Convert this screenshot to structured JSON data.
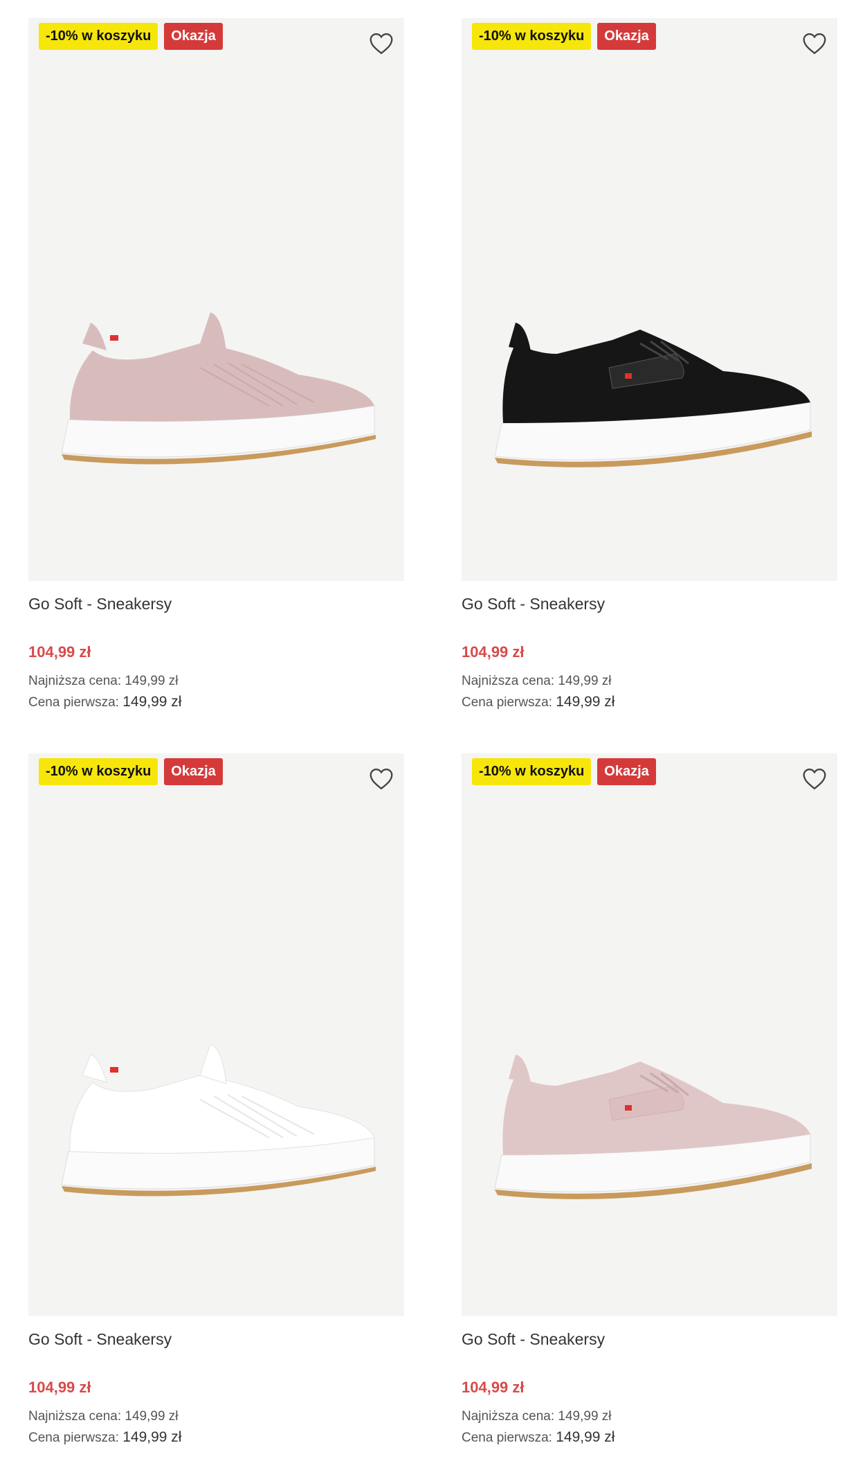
{
  "colors": {
    "sale_price": "#d84a4a",
    "badge_yellow": "#f6e60a",
    "badge_red": "#d53a3a",
    "image_bg": "#f4f4f3"
  },
  "products": [
    {
      "badge_discount": "-10% w koszyku",
      "badge_deal": "Okazja",
      "name": "Go Soft - Sneakersy",
      "price": "104,99 zł",
      "lowest_label": "Najniższa cena:",
      "lowest_value": "149,99 zł",
      "first_label": "Cena pierwsza:",
      "first_value": "149,99 zł",
      "image_color": "pink",
      "style": "slip-on",
      "icon": "heart-outline-icon"
    },
    {
      "badge_discount": "-10% w koszyku",
      "badge_deal": "Okazja",
      "name": "Go Soft - Sneakersy",
      "price": "104,99 zł",
      "lowest_label": "Najniższa cena:",
      "lowest_value": "149,99 zł",
      "first_label": "Cena pierwsza:",
      "first_value": "149,99 zł",
      "image_color": "black",
      "style": "lace-up",
      "icon": "heart-outline-icon"
    },
    {
      "badge_discount": "-10% w koszyku",
      "badge_deal": "Okazja",
      "name": "Go Soft - Sneakersy",
      "price": "104,99 zł",
      "lowest_label": "Najniższa cena:",
      "lowest_value": "149,99 zł",
      "first_label": "Cena pierwsza:",
      "first_value": "149,99 zł",
      "image_color": "white",
      "style": "slip-on",
      "icon": "heart-outline-icon"
    },
    {
      "badge_discount": "-10% w koszyku",
      "badge_deal": "Okazja",
      "name": "Go Soft - Sneakersy",
      "price": "104,99 zł",
      "lowest_label": "Najniższa cena:",
      "lowest_value": "149,99 zł",
      "first_label": "Cena pierwsza:",
      "first_value": "149,99 zł",
      "image_color": "pink",
      "style": "lace-up",
      "icon": "heart-outline-icon"
    }
  ]
}
